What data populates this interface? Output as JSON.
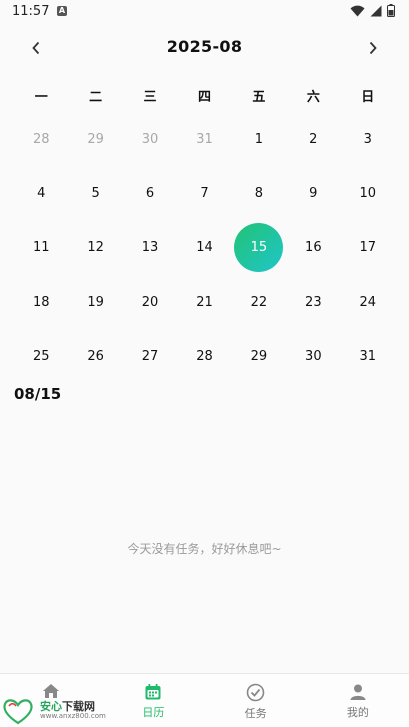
{
  "status": {
    "time": "11:57",
    "notif_letter": "A"
  },
  "header": {
    "title": "2025-08"
  },
  "weekdays": [
    "一",
    "二",
    "三",
    "四",
    "五",
    "六",
    "日"
  ],
  "calendar": {
    "weeks": [
      [
        "28",
        "29",
        "30",
        "31",
        "1",
        "2",
        "3"
      ],
      [
        "4",
        "5",
        "6",
        "7",
        "8",
        "9",
        "10"
      ],
      [
        "11",
        "12",
        "13",
        "14",
        "15",
        "16",
        "17"
      ],
      [
        "18",
        "19",
        "20",
        "21",
        "22",
        "23",
        "24"
      ],
      [
        "25",
        "26",
        "27",
        "28",
        "29",
        "30",
        "31"
      ]
    ],
    "muted": [
      [
        0,
        0
      ],
      [
        0,
        1
      ],
      [
        0,
        2
      ],
      [
        0,
        3
      ]
    ],
    "selected": [
      2,
      4
    ],
    "accent_start": "#22c274",
    "accent_end": "#1fc6c9"
  },
  "selected_date": "08/15",
  "empty_message": "今天没有任务，好好休息吧~",
  "tabs": [
    {
      "label": "",
      "icon": "home-icon",
      "active": false
    },
    {
      "label": "日历",
      "icon": "calendar-icon",
      "active": true
    },
    {
      "label": "任务",
      "icon": "check-circle-icon",
      "active": false
    },
    {
      "label": "我的",
      "icon": "user-icon",
      "active": false
    }
  ],
  "watermark": {
    "title_green": "安心",
    "title_rest": "下载网",
    "url": "www.anxz800.com"
  }
}
